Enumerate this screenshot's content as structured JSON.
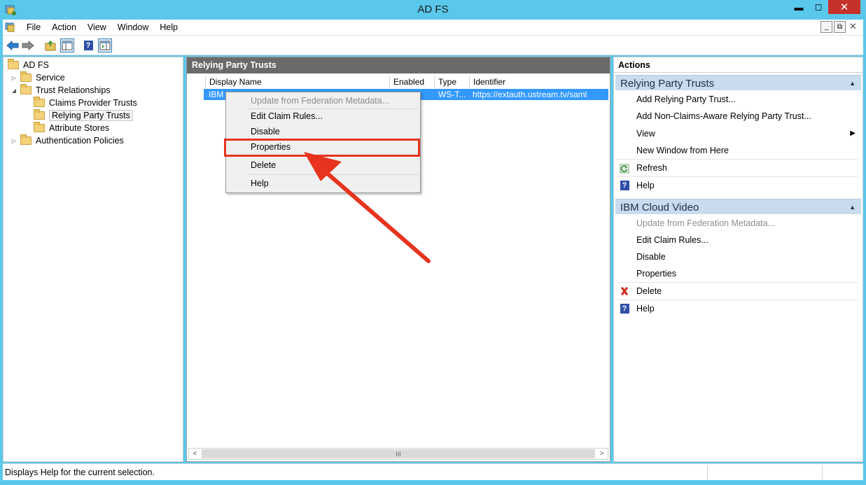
{
  "window": {
    "title": "AD FS",
    "minimize": "▬",
    "maximize": "◻",
    "close": "✕"
  },
  "menu": [
    "File",
    "Action",
    "View",
    "Window",
    "Help"
  ],
  "mdi": {
    "minimize": "_",
    "restore": "⧉",
    "close": "✕"
  },
  "tree": {
    "root": "AD FS",
    "items": [
      {
        "label": "Service",
        "level": 1,
        "twisty": "▷"
      },
      {
        "label": "Trust Relationships",
        "level": 1,
        "twisty": "◢"
      },
      {
        "label": "Claims Provider Trusts",
        "level": 2,
        "twisty": ""
      },
      {
        "label": "Relying Party Trusts",
        "level": 2,
        "twisty": "",
        "selected": true
      },
      {
        "label": "Attribute Stores",
        "level": 2,
        "twisty": ""
      },
      {
        "label": "Authentication Policies",
        "level": 1,
        "twisty": "▷"
      }
    ]
  },
  "center": {
    "title": "Relying Party Trusts",
    "columns": [
      "Display Name",
      "Enabled",
      "Type",
      "Identifier"
    ],
    "row": {
      "display_name": "IBM C",
      "type": "WS-T...",
      "identifier": "https://extauth.ustream.tv/saml"
    }
  },
  "context_menu": {
    "items": [
      "Update from Federation Metadata...",
      "Edit Claim Rules...",
      "Disable",
      "Properties",
      "Delete",
      "Help"
    ]
  },
  "actions": {
    "title": "Actions",
    "section1": {
      "title": "Relying Party Trusts",
      "items": [
        "Add Relying Party Trust...",
        "Add Non-Claims-Aware Relying Party Trust...",
        "View",
        "New Window from Here",
        "Refresh",
        "Help"
      ]
    },
    "section2": {
      "title": "IBM Cloud Video",
      "items": [
        "Update from Federation Metadata...",
        "Edit Claim Rules...",
        "Disable",
        "Properties",
        "Delete",
        "Help"
      ]
    }
  },
  "status": {
    "text": "Displays Help for the current selection."
  },
  "scroll": {
    "left": "<",
    "right": ">",
    "grip": "III"
  },
  "glyphs": {
    "caret_up": "▲",
    "submenu": "▶",
    "help": "?"
  },
  "colors": {
    "title_bar": "#5ac8ea",
    "selection": "#3399ff",
    "highlight": "#e8341f",
    "section_header": "#c9dcee"
  }
}
